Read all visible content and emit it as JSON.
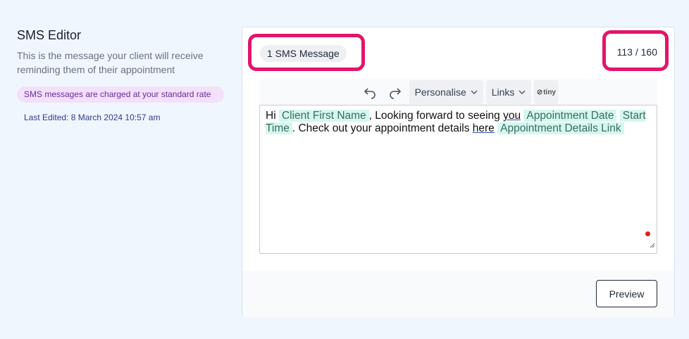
{
  "sidebar": {
    "title": "SMS Editor",
    "description": "This is the message your client will receive reminding them of their appointment",
    "charge_notice": "SMS messages are charged at your standard rate",
    "last_edited": "Last Edited: 8 March 2024 10:57 am"
  },
  "editor": {
    "sms_count": "1 SMS Message",
    "char_count": "113 / 160",
    "toolbar": {
      "undo_icon": "undo-icon",
      "redo_icon": "redo-icon",
      "personalise_label": "Personalise",
      "links_label": "Links",
      "tiny_label": "tiny"
    },
    "content": {
      "t1": "Hi ",
      "tag_client_first_name": "Client First Name",
      "t2": ", Looking forward to seeing ",
      "link_you": "you",
      "tag_appointment_date": "Appointment Date",
      "tag_start_time": "Start Time",
      "t3": ". Check out your appointment details ",
      "link_here": "here",
      "tag_appointment_details_link": "Appointment Details Link"
    },
    "preview_label": "Preview"
  },
  "colors": {
    "highlight": "#e2156b",
    "tag_bg": "#d5f7ee",
    "badge_bg": "#f3e0fb"
  }
}
